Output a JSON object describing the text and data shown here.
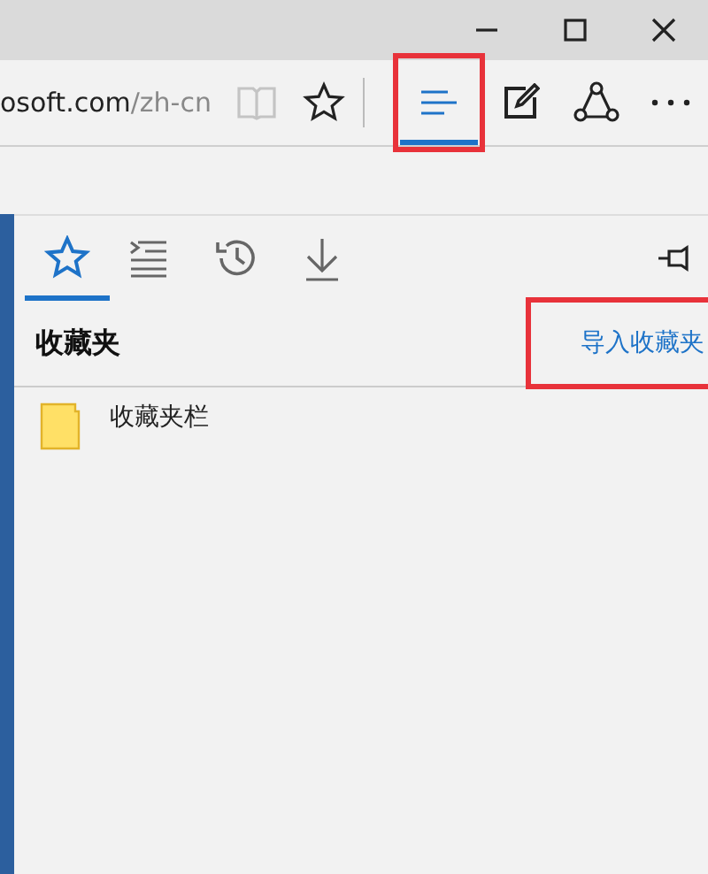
{
  "window": {
    "title_buttons": [
      {
        "kind": "minimize"
      },
      {
        "kind": "maximize"
      },
      {
        "kind": "close"
      }
    ]
  },
  "address": {
    "host": "osoft.com",
    "path": "/zh-cn"
  },
  "toolbar": [
    {
      "kind": "reading",
      "disabled": true,
      "selected": false,
      "annotated": false
    },
    {
      "kind": "favorite",
      "disabled": false,
      "selected": false,
      "annotated": false
    },
    {
      "kind": "separator"
    },
    {
      "kind": "hub",
      "disabled": false,
      "selected": true,
      "annotated": true
    },
    {
      "kind": "note",
      "disabled": false,
      "selected": false,
      "annotated": false
    },
    {
      "kind": "share",
      "disabled": false,
      "selected": false,
      "annotated": false
    },
    {
      "kind": "more",
      "disabled": false,
      "selected": false,
      "annotated": false
    }
  ],
  "hub": {
    "tabs": [
      {
        "kind": "favorites",
        "selected": true
      },
      {
        "kind": "reading_list",
        "selected": false
      },
      {
        "kind": "history",
        "selected": false
      },
      {
        "kind": "downloads",
        "selected": false
      }
    ],
    "pinned": false,
    "title": "收藏夹",
    "import_link": {
      "label": "导入收藏夹",
      "annotated": true
    },
    "items": [
      {
        "label": "收藏夹栏",
        "kind": "folder"
      }
    ]
  }
}
